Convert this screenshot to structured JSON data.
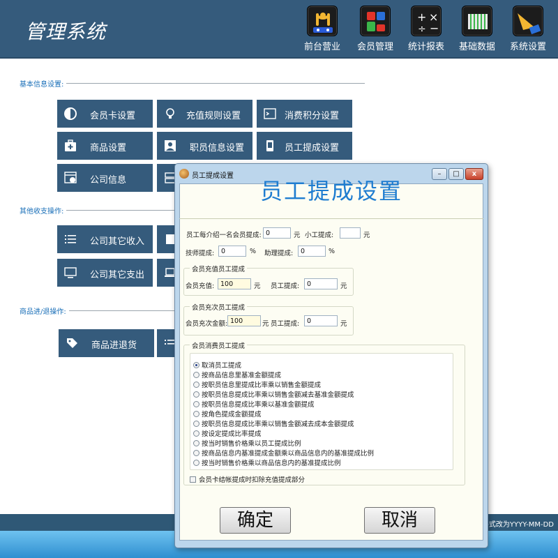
{
  "header": {
    "title": "管理系统",
    "nav": [
      {
        "label": "前台营业",
        "icon": "cashier-icon"
      },
      {
        "label": "会员管理",
        "icon": "members-icon"
      },
      {
        "label": "统计报表",
        "icon": "calculator-icon"
      },
      {
        "label": "基础数据",
        "icon": "database-icon"
      },
      {
        "label": "系统设置",
        "icon": "settings-icon"
      }
    ],
    "colors": {
      "header_bg": "#355b7c",
      "tile_bg": "#355b7c",
      "accent": "#1f7dd0"
    }
  },
  "sections": {
    "basic": "基本信息设置:",
    "other": "其他收支操作:",
    "goods": "商品进/退操作:"
  },
  "tiles": {
    "member_card": "会员卡设置",
    "recharge_rules": "充值规则设置",
    "points": "消费积分设置",
    "goods": "商品设置",
    "staff_info": "职员信息设置",
    "staff_commission": "员工提成设置",
    "company_info": "公司信息",
    "other_income": "公司其它收入",
    "other_expense": "公司其它支出",
    "goods_inout": "商品进退货"
  },
  "status": {
    "text": "期格式改为YYYY-MM-DD"
  },
  "dialog": {
    "window_title": "员工提成设置",
    "heading": "员工提成设置",
    "win_min": "–",
    "win_max": "□",
    "win_close": "x",
    "fields": {
      "referral_label": "员工每介绍一名会员提成:",
      "referral_value": "0",
      "referral_unit": "元",
      "junior_label": "小工提成:",
      "junior_value": "",
      "junior_unit": "元",
      "tech_label": "技师提成:",
      "tech_value": "0",
      "tech_unit": "%",
      "assist_label": "助理提成:",
      "assist_value": "0",
      "assist_unit": "%"
    },
    "recharge_group": {
      "title": "会员充值员工提成",
      "amount_label": "会员充值:",
      "amount_value": "100",
      "amount_unit": "元",
      "commission_label": "员工提成:",
      "commission_value": "0",
      "commission_unit": "元"
    },
    "count_group": {
      "title": "会员充次员工提成",
      "amount_label": "会员充次金额:",
      "amount_value": "100",
      "amount_unit": "元",
      "commission_label": "员工提成:",
      "commission_value": "0",
      "commission_unit": "元"
    },
    "consume_group": {
      "title": "会员消费员工提成",
      "options": [
        "取消员工提成",
        "按商品信息里基准金额提成",
        "按职员信息里提成比率乘以销售金额提成",
        "按职员信息提成比率乘以销售金额减去基准金额提成",
        "按职员信息提成比率乘以基准金额提成",
        "按角色提成金额提成",
        "按职员信息提成比率乘以销售金额减去成本金额提成",
        "按设定提成比率提成",
        "按当时销售价格乘以员工提成比例",
        "按商品信息内基准提成金额乘以商品信息内的基准提成比例",
        "按当时销售价格乘以商品信息内的基准提成比例"
      ],
      "selected_index": 0
    },
    "checkbox_label": "会员卡结帐提成时扣除充值提成部分",
    "ok_label": "确定",
    "cancel_label": "取消"
  }
}
